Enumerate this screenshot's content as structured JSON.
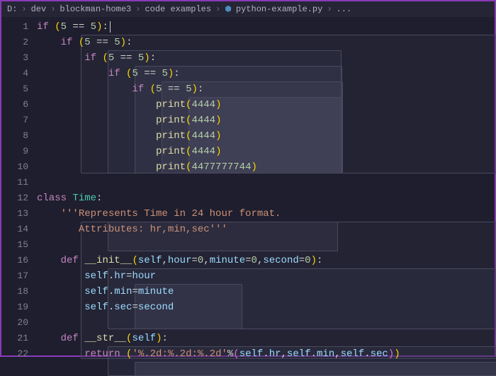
{
  "breadcrumb": {
    "drive": "D:",
    "items": [
      "dev",
      "blockman-home3",
      "code examples"
    ],
    "file": "python-example.py",
    "tail": "..."
  },
  "editor": {
    "line_numbers": [
      "1",
      "2",
      "3",
      "4",
      "5",
      "6",
      "7",
      "8",
      "9",
      "10",
      "11",
      "12",
      "13",
      "14",
      "15",
      "16",
      "17",
      "18",
      "19",
      "20",
      "21",
      "22"
    ],
    "tokens": {
      "if": "if",
      "five": "5",
      "eqeq": "==",
      "print": "print",
      "v4444": "4444",
      "vlong": "4477777744",
      "class": "class",
      "Time": "Time",
      "doc1": "'''Represents Time in 24 hour format.",
      "doc2": "   Attributes: hr,min,sec'''",
      "def": "def",
      "init": "__init__",
      "self": "self",
      "hour": "hour",
      "minute": "minute",
      "second": "second",
      "zero": "0",
      "hr": "hr",
      "min": "min",
      "sec": "sec",
      "str": "__str__",
      "return": "return",
      "fmt": "'%.2d:%.2d:%.2d'",
      "pct": "%"
    }
  }
}
